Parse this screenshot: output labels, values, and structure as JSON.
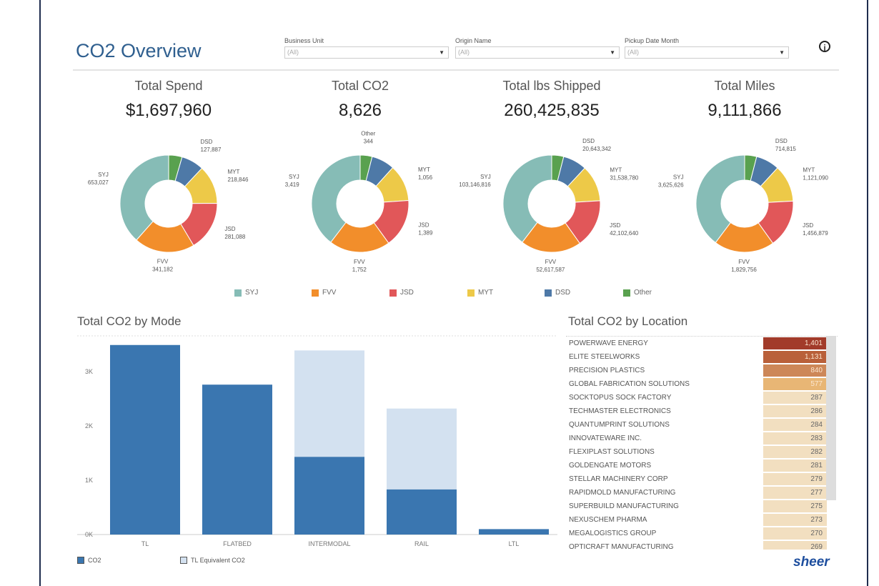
{
  "header": {
    "title": "CO2 Overview",
    "filters": [
      {
        "label": "Business Unit",
        "value": "(All)"
      },
      {
        "label": "Origin Name",
        "value": "(All)"
      },
      {
        "label": "Pickup Date Month",
        "value": "(All)"
      }
    ],
    "info_icon": "info-icon"
  },
  "colors": {
    "SYJ": "#86bcb6",
    "FVV": "#f28e2b",
    "JSD": "#e15759",
    "MYT": "#edc948",
    "DSD": "#4e79a7",
    "Other": "#59a14f",
    "bar": "#3a76b0",
    "bar_equiv": "#d3e1f0"
  },
  "kpis": [
    {
      "label": "Total Spend",
      "value": "$1,697,960",
      "total": 1697960,
      "slices": {
        "Other": null,
        "DSD": "127,887",
        "MYT": "218,846",
        "JSD": "281,088",
        "FVV": "341,182",
        "SYJ": "653,027"
      }
    },
    {
      "label": "Total CO2",
      "value": "8,626",
      "total": 8626,
      "slices": {
        "Other": "344",
        "DSD": null,
        "MYT": "1,056",
        "JSD": "1,389",
        "FVV": "1,752",
        "SYJ": "3,419"
      }
    },
    {
      "label": "Total lbs Shipped",
      "value": "260,425,835",
      "total": 260425835,
      "slices": {
        "Other": null,
        "DSD": "20,643,342",
        "MYT": "31,538,780",
        "JSD": "42,102,640",
        "FVV": "52,617,587",
        "SYJ": "103,146,816"
      }
    },
    {
      "label": "Total Miles",
      "value": "9,111,866",
      "total": 9111866,
      "slices": {
        "Other": null,
        "DSD": "714,815",
        "MYT": "1,121,090",
        "JSD": "1,456,879",
        "FVV": "1,829,756",
        "SYJ": "3,625,626"
      }
    }
  ],
  "legend": [
    "SYJ",
    "FVV",
    "JSD",
    "MYT",
    "DSD",
    "Other"
  ],
  "chart_data": {
    "type": "bar",
    "title": "Total CO2 by Mode",
    "categories": [
      "TL",
      "FLATBED",
      "INTERMODAL",
      "RAIL",
      "LTL"
    ],
    "series": [
      {
        "name": "CO2",
        "values": [
          3490,
          2760,
          1430,
          830,
          100
        ]
      },
      {
        "name": "TL Equivalent CO2",
        "values": [
          null,
          null,
          3390,
          2320,
          null
        ]
      }
    ],
    "yticks": [
      "0K",
      "1K",
      "2K",
      "3K"
    ],
    "ylim": [
      0,
      3600
    ]
  },
  "location": {
    "title": "Total CO2 by Location",
    "rows": [
      [
        "POWERWAVE ENERGY",
        "1,401"
      ],
      [
        "ELITE STEELWORKS",
        "1,131"
      ],
      [
        "PRECISION PLASTICS",
        "840"
      ],
      [
        "GLOBAL FABRICATION SOLUTIONS",
        "577"
      ],
      [
        "SOCKTOPUS SOCK FACTORY",
        "287"
      ],
      [
        "TECHMASTER ELECTRONICS",
        "286"
      ],
      [
        "QUANTUMPRINT SOLUTIONS",
        "284"
      ],
      [
        "INNOVATEWARE INC.",
        "283"
      ],
      [
        "FLEXIPLAST SOLUTIONS",
        "282"
      ],
      [
        "GOLDENGATE MOTORS",
        "281"
      ],
      [
        "STELLAR MACHINERY CORP",
        "279"
      ],
      [
        "RAPIDMOLD MANUFACTURING",
        "277"
      ],
      [
        "SUPERBUILD MANUFACTURING",
        "275"
      ],
      [
        "NEXUSCHEM PHARMA",
        "273"
      ],
      [
        "MEGALOGISTICS GROUP",
        "270"
      ],
      [
        "OPTICRAFT MANUFACTURING",
        "269"
      ]
    ]
  },
  "brand": "sheer"
}
